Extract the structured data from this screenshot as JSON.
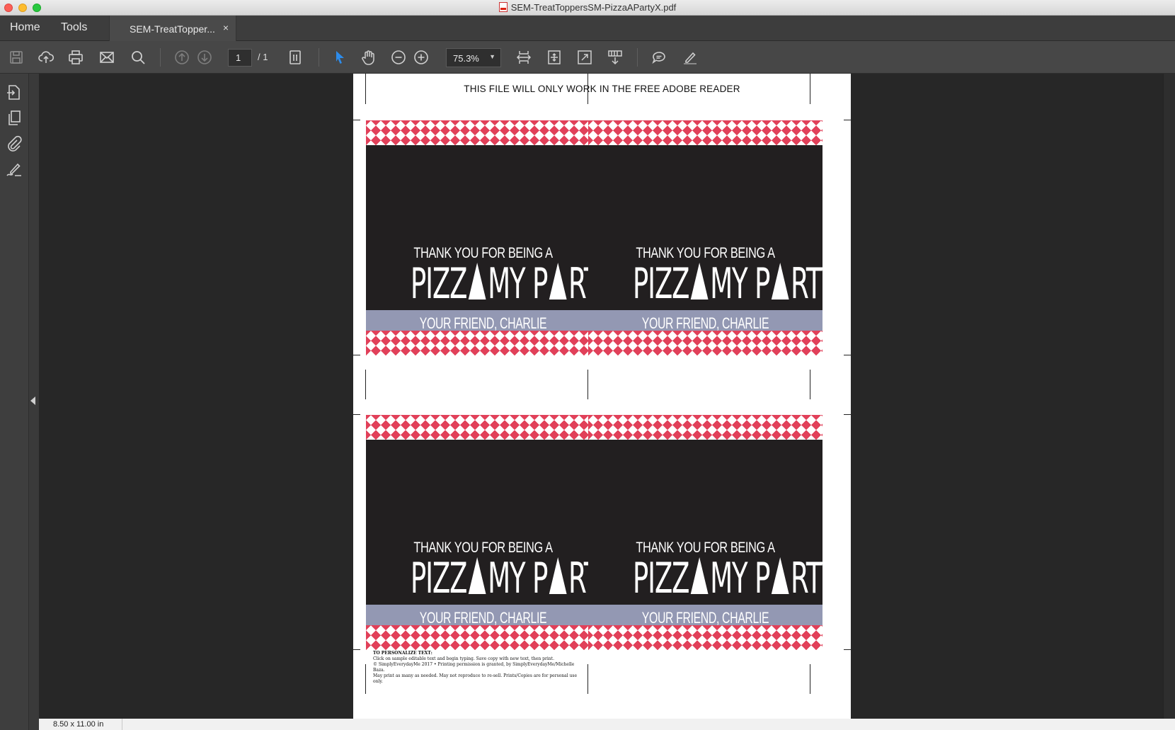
{
  "window": {
    "title": "SEM-TreatToppersSM-PizzaAPartyX.pdf"
  },
  "tabs": {
    "home": "Home",
    "tools": "Tools",
    "document": "SEM-TreatTopper...",
    "document_close": "×"
  },
  "toolbar": {
    "icons": [
      "save-icon",
      "upload-icon",
      "print-icon",
      "email-icon",
      "search-icon",
      "prev-page-icon",
      "next-page-icon",
      "page-fit-icon",
      "select-icon",
      "hand-icon",
      "zoom-out-icon",
      "zoom-in-icon",
      "fit-width-icon",
      "fit-page-icon",
      "full-screen-icon",
      "scroll-mode-icon",
      "comment-icon",
      "sign-icon"
    ],
    "page_current": "1",
    "page_total": "/ 1",
    "zoom": "75.3%"
  },
  "rail": {
    "icons": [
      "export-pdf-icon",
      "organize-pages-icon",
      "attachments-icon",
      "fill-sign-icon"
    ]
  },
  "document": {
    "header": "THIS FILE WILL ONLY WORK IN THE FREE ADOBE READER",
    "cards": [
      {
        "thanks": "THANK YOU FOR BEING A",
        "title_a": "PIZZ",
        "title_b": "MY P",
        "title_c": "RTY!",
        "friend": "YOUR FRIEND, CHARLIE"
      },
      {
        "thanks": "THANK YOU FOR BEING A",
        "title_a": "PIZZ",
        "title_b": "MY P",
        "title_c": "RTY!",
        "friend": "YOUR FRIEND, CHARLIE"
      },
      {
        "thanks": "THANK YOU FOR BEING A",
        "title_a": "PIZZ",
        "title_b": "MY P",
        "title_c": "RTY!",
        "friend": "YOUR FRIEND, CHARLIE"
      },
      {
        "thanks": "THANK YOU FOR BEING A",
        "title_a": "PIZZ",
        "title_b": "MY P",
        "title_c": "RTY!",
        "friend": "YOUR FRIEND, CHARLIE"
      }
    ],
    "fine_print": {
      "heading": "TO PERSONALIZE TEXT:",
      "line1": "Click on sample editable text and begin typing. Save copy with new text, then print.",
      "line2": "© SimplyEverydayMe 2017 • Printing permission is granted, by SimplyEverydayMe/Michelle Baza.",
      "line3": "May print as many as needed. May not reproduce to re-sell. Prints/Copies are for personal use only."
    }
  },
  "status": {
    "page_size": "8.50 x 11.00 in"
  },
  "colors": {
    "checker_red": "#dc1e3c",
    "card_dark": "#221f20",
    "band_lavender": "#9398b3",
    "toolbar_bg": "#474747",
    "select_tool_blue": "#2d8ceb"
  }
}
